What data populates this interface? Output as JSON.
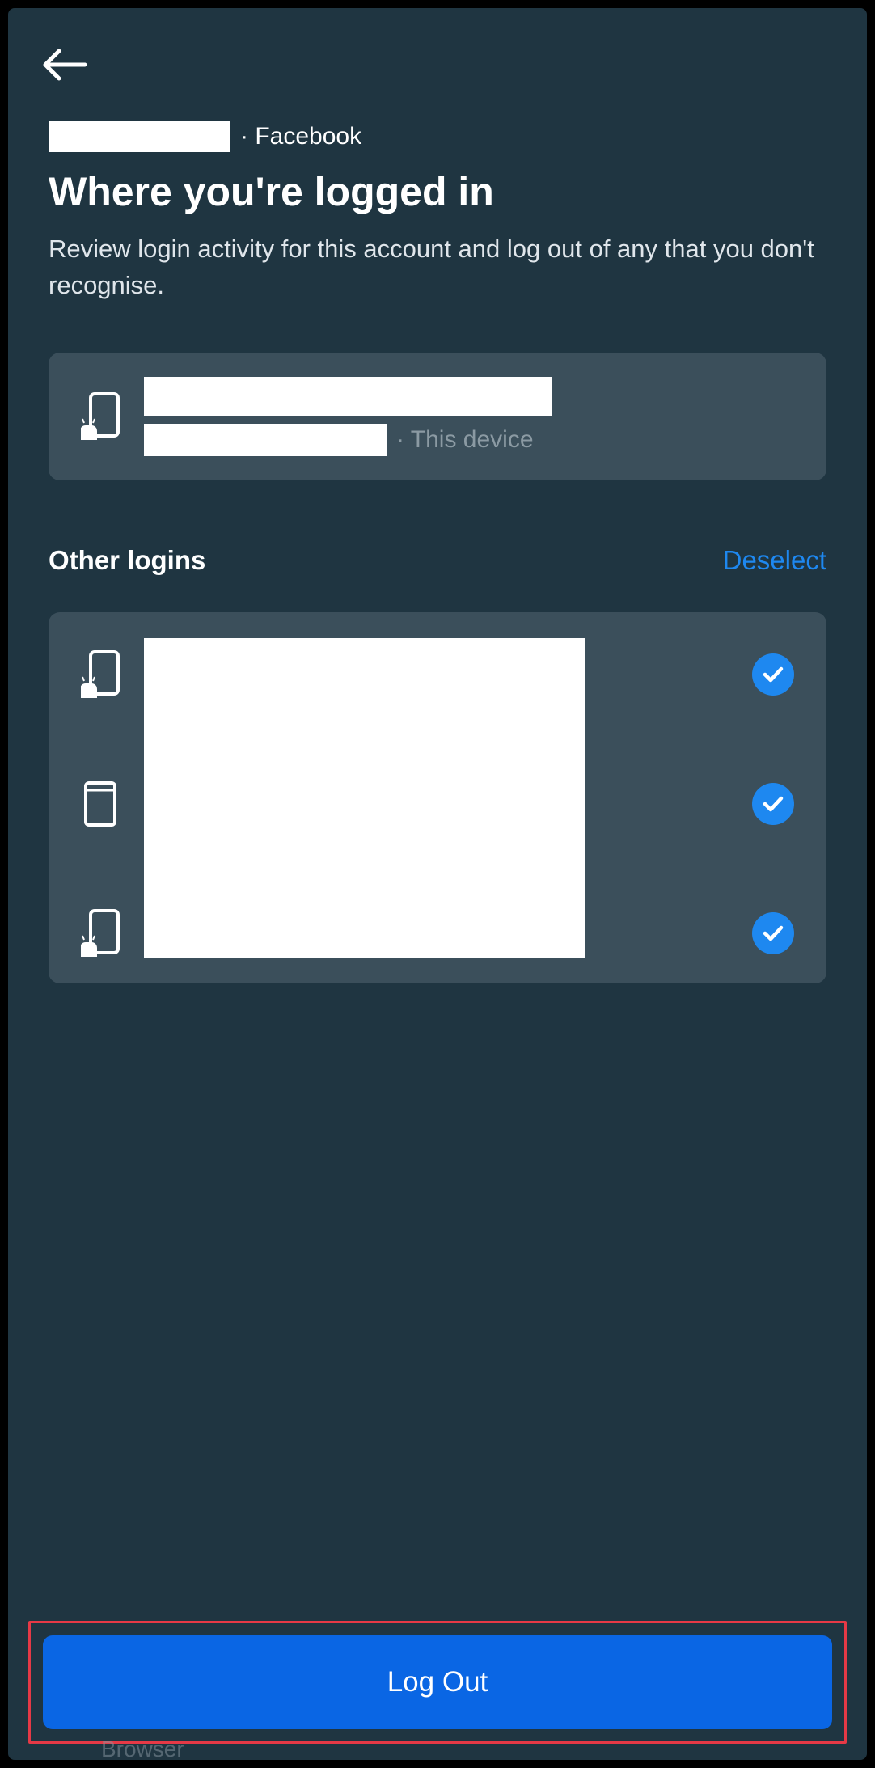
{
  "header": {
    "breadcrumb_app": "Facebook"
  },
  "page": {
    "title": "Where you're logged in",
    "description": "Review login activity for this account and log out of any that you don't recognise."
  },
  "current_device": {
    "label_suffix": "· This device"
  },
  "other_logins": {
    "title": "Other logins",
    "deselect_label": "Deselect",
    "items": [
      {
        "icon": "android-phone",
        "selected": true
      },
      {
        "icon": "tablet",
        "selected": true
      },
      {
        "icon": "android-phone",
        "selected": true
      }
    ]
  },
  "actions": {
    "logout_label": "Log Out"
  },
  "under": {
    "text": "Browser"
  },
  "colors": {
    "background": "#1f3541",
    "card": "#3b4f5b",
    "accent_blue": "#1e88f0",
    "button_blue": "#0a66e4",
    "highlight_red": "#e63946"
  }
}
